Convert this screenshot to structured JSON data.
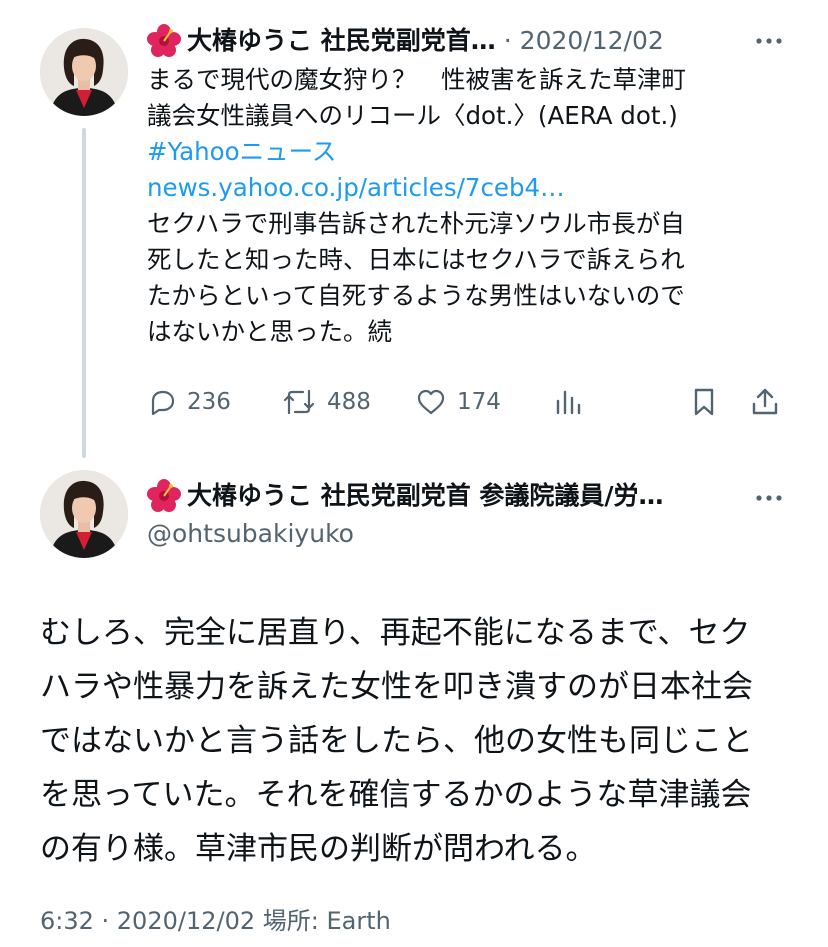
{
  "tweet1": {
    "display_name": "大椿ゆうこ 社民党副党首…",
    "separator": "·",
    "date": "2020/12/02",
    "text_lines": [
      "まるで現代の魔女狩り？　性被害を訴えた草津町",
      "議会女性議員へのリコール〈dot.〉(AERA dot.)"
    ],
    "hashtag": "#Yahooニュース",
    "url": "news.yahoo.co.jp/articles/7ceb4…",
    "text_lines_2": [
      "セクハラで刑事告訴された朴元淳ソウル市長が自",
      "死したと知った時、日本にはセクハラで訴えられ",
      "たからといって自死するような男性はいないので",
      "はないかと思った。続"
    ],
    "actions": {
      "replies": "236",
      "retweets": "488",
      "likes": "174"
    },
    "icons": [
      "reply-icon",
      "retweet-icon",
      "like-icon",
      "views-icon",
      "bookmark-icon",
      "share-icon",
      "more-icon"
    ]
  },
  "tweet2": {
    "display_name": "大椿ゆうこ 社民党副党首 参議院議員/労…",
    "handle": "@ohtsubakiyuko",
    "text_lines": [
      "むしろ、完全に居直り、再起不能になるまで、セク",
      "ハラや性暴力を訴えた女性を叩き潰すのが日本社会",
      "ではないかと言う話をしたら、他の女性も同じこと",
      "を思っていた。それを確信するかのような草津議会",
      "の有り様。草津市民の判断が問われる。"
    ],
    "meta": "6:32 · 2020/12/02 場所: Earth"
  },
  "colors": {
    "text": "#0f1419",
    "secondary": "#536471",
    "link": "#1d9bf0",
    "thread_line": "#cfd9de",
    "hibiscus": "#e0245e"
  }
}
